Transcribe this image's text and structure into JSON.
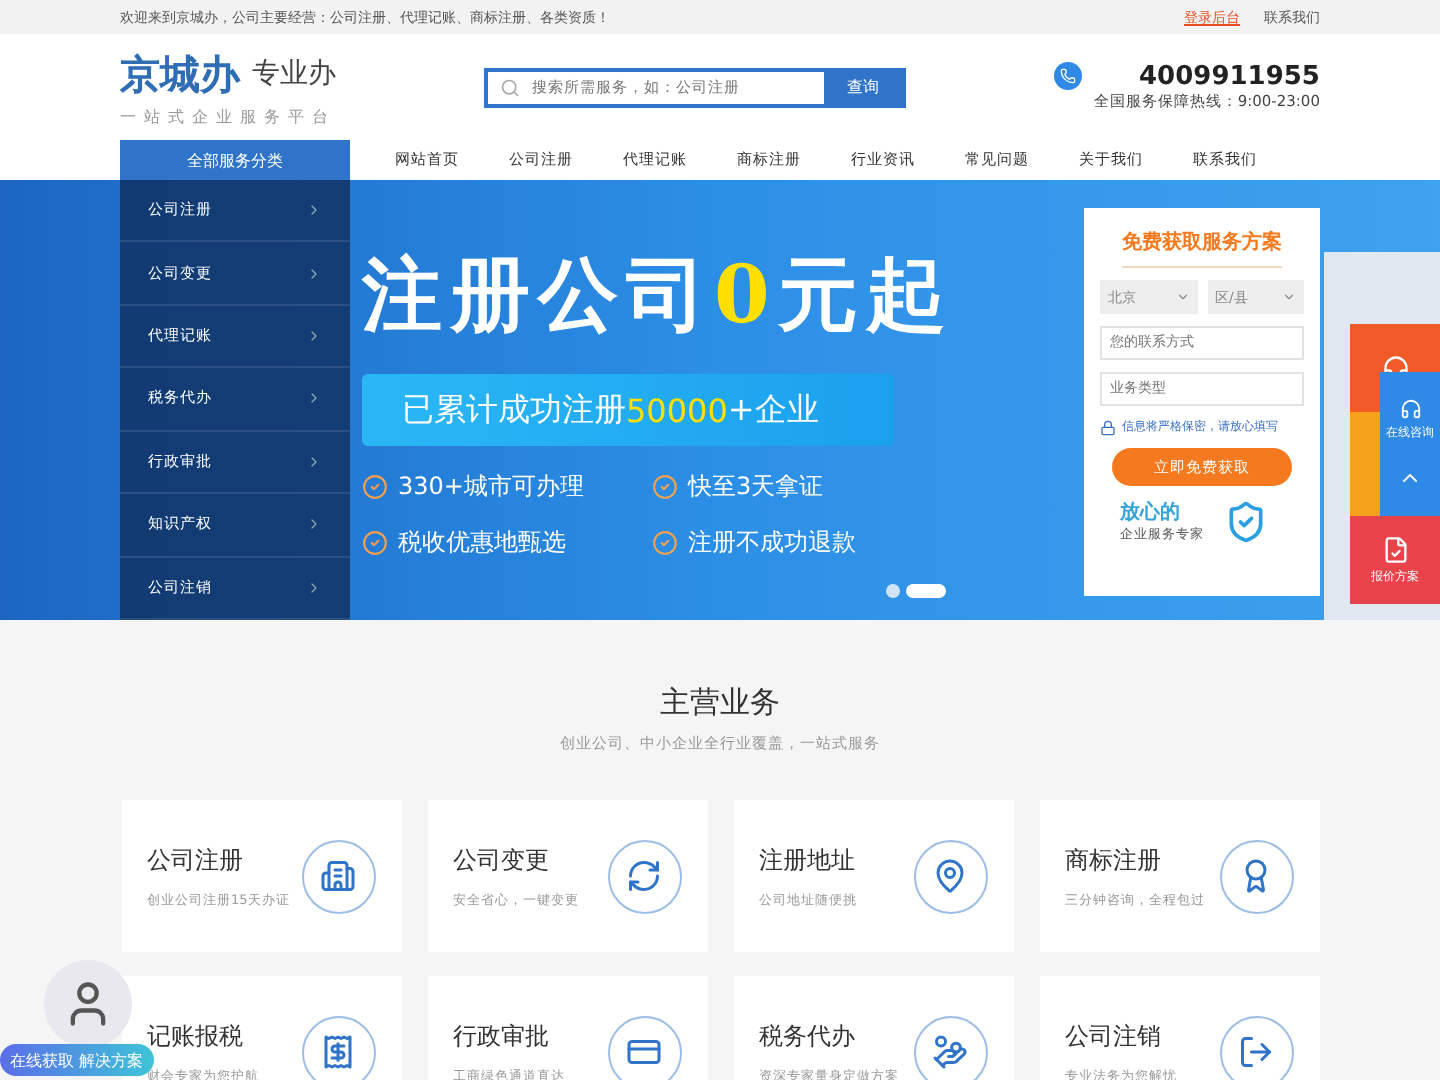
{
  "top_bar": {
    "welcome": "欢迎来到京城办，公司主要经营：公司注册、代理记账、商标注册、各类资质！",
    "links": [
      {
        "label": "登录后台",
        "kind": "highlight"
      },
      {
        "label": "联系我们",
        "kind": "plain"
      }
    ]
  },
  "header": {
    "logo_main": "京城办",
    "logo_slogan": "专业办",
    "logo_tagline": "一站式企业服务平台",
    "search": {
      "placeholder": "搜索所需服务，如：公司注册",
      "button": "查询"
    },
    "phone": "4009911955",
    "hotline": "全国服务保障热线：9:00-23:00"
  },
  "nav": {
    "category_button": "全部服务分类",
    "items": [
      "网站首页",
      "公司注册",
      "代理记账",
      "商标注册",
      "行业资讯",
      "常见问题",
      "关于我们",
      "联系我们"
    ]
  },
  "side_menu": [
    "公司注册",
    "公司变更",
    "代理记账",
    "税务代办",
    "行政审批",
    "知识产权",
    "公司注销"
  ],
  "banner": {
    "headline": {
      "before": "注册公司",
      "highlight": "0",
      "after": "元起"
    },
    "stat": {
      "before": "已累计成功注册",
      "highlight": "50000",
      "after": "+企业"
    },
    "features": [
      "330+城市可办理",
      "快至3天拿证",
      "税收优惠地甄选",
      "注册不成功退款"
    ],
    "dots": [
      {
        "selected": false
      },
      {
        "selected": true
      }
    ]
  },
  "form": {
    "title": "免费获取服务方案",
    "city": "北京",
    "district": "区/县",
    "contact_placeholder": "您的联系方式",
    "type_placeholder": "业务类型",
    "privacy": "信息将严格保密，请放心填写",
    "submit": "立即免费获取",
    "badge_title": "放心的",
    "badge_subtitle": "企业服务专家"
  },
  "float_bar": {
    "consult": "在线咨询",
    "quote": "报价方案"
  },
  "section": {
    "title": "主营业务",
    "subtitle": "创业公司、中小企业全行业覆盖，一站式服务"
  },
  "services": [
    {
      "title": "公司注册",
      "desc": "创业公司注册15天办证",
      "kind": "building"
    },
    {
      "title": "公司变更",
      "desc": "安全省心，一键变更",
      "kind": "change"
    },
    {
      "title": "注册地址",
      "desc": "公司地址随便挑",
      "kind": "pin"
    },
    {
      "title": "商标注册",
      "desc": "三分钟咨询，全程包过",
      "kind": "award"
    },
    {
      "title": "记账报税",
      "desc": "财会专家为您护航",
      "kind": "receipt"
    },
    {
      "title": "行政审批",
      "desc": "工商绿色通道直达",
      "kind": "card"
    },
    {
      "title": "税务代办",
      "desc": "资深专家量身定做方案",
      "kind": "hand"
    },
    {
      "title": "公司注销",
      "desc": "专业法务为您解忧",
      "kind": "exit"
    }
  ],
  "chat_widget": {
    "label": "在线获取 解决方案"
  }
}
